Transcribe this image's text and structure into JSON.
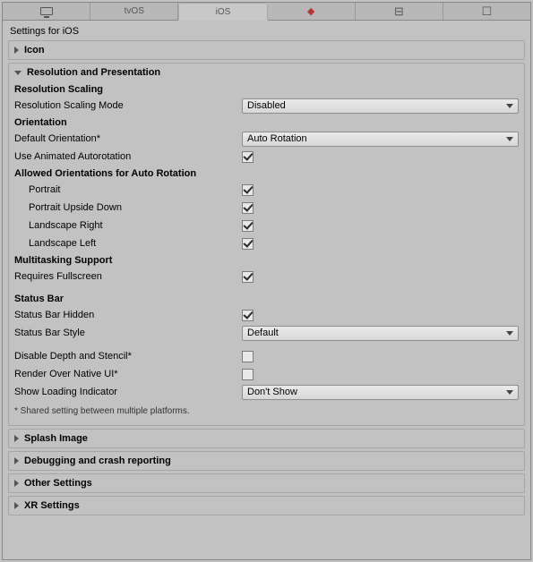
{
  "tabs": {
    "standalone": "",
    "tvos": "tvOS",
    "ios": "iOS",
    "lumin": "",
    "android": "",
    "webgl": ""
  },
  "title": "Settings for iOS",
  "sections": {
    "icon": {
      "title": "Icon"
    },
    "resolution": {
      "title": "Resolution and Presentation",
      "resScaling": "Resolution Scaling",
      "resScalingMode_label": "Resolution Scaling Mode",
      "resScalingMode_value": "Disabled",
      "orientation": "Orientation",
      "defaultOrientation_label": "Default Orientation*",
      "defaultOrientation_value": "Auto Rotation",
      "useAnimatedAutorotation_label": "Use Animated Autorotation",
      "allowedOrientations": "Allowed Orientations for Auto Rotation",
      "portrait_label": "Portrait",
      "portraitUpsideDown_label": "Portrait Upside Down",
      "landscapeRight_label": "Landscape Right",
      "landscapeLeft_label": "Landscape Left",
      "multitasking": "Multitasking Support",
      "requiresFullscreen_label": "Requires Fullscreen",
      "statusBar": "Status Bar",
      "statusBarHidden_label": "Status Bar Hidden",
      "statusBarStyle_label": "Status Bar Style",
      "statusBarStyle_value": "Default",
      "disableDepthStencil_label": "Disable Depth and Stencil*",
      "renderOverNativeUI_label": "Render Over Native UI*",
      "showLoadingIndicator_label": "Show Loading Indicator",
      "showLoadingIndicator_value": "Don't Show",
      "footnote": "* Shared setting between multiple platforms."
    },
    "splash": {
      "title": "Splash Image"
    },
    "debug": {
      "title": "Debugging and crash reporting"
    },
    "other": {
      "title": "Other Settings"
    },
    "xr": {
      "title": "XR Settings"
    }
  },
  "checks": {
    "useAnimatedAutorotation": true,
    "portrait": true,
    "portraitUpsideDown": true,
    "landscapeRight": true,
    "landscapeLeft": true,
    "requiresFullscreen": true,
    "statusBarHidden": true,
    "disableDepthStencil": false,
    "renderOverNativeUI": false
  }
}
